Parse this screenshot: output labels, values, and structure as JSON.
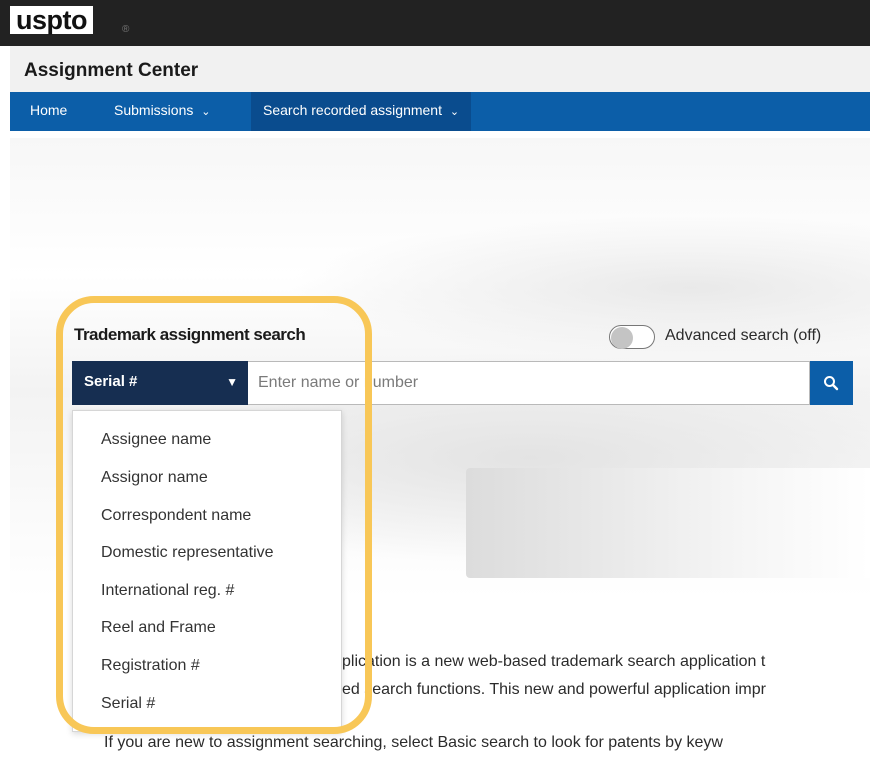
{
  "header": {
    "logo_text": "uspto",
    "app_title": "Assignment Center"
  },
  "nav": {
    "items": [
      {
        "label": "Home",
        "caret": ""
      },
      {
        "label": "Submissions",
        "caret": "⌄"
      },
      {
        "label": "Search recorded assignment",
        "caret": "⌄"
      }
    ]
  },
  "search": {
    "title": "Trademark assignment search",
    "advanced_label": "Advanced search (off)",
    "advanced_on": false,
    "field_selected": "Serial #",
    "placeholder": "Enter name or number",
    "button_icon": "search-icon"
  },
  "dropdown": {
    "options": [
      "Assignee name",
      "Assignor name",
      "Correspondent name",
      "Domestic representative",
      "International reg. #",
      "Reel and Frame",
      "Registration #",
      "Serial #"
    ]
  },
  "description": {
    "line1_visible": "plication is a new web-based trademark search application t",
    "line2_visible": "ed search functions. This new and powerful application impr",
    "line3_visible": "If you are new to assignment searching, select Basic search to look for patents by keyw"
  },
  "colors": {
    "topbar": "#222222",
    "nav": "#0c5ea8",
    "field_select": "#162e51",
    "highlight": "#f8c757"
  }
}
